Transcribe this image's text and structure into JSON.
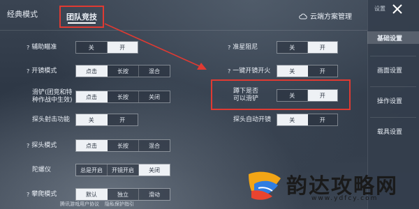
{
  "tabs": {
    "classic": "经典模式",
    "team": "团队竞技"
  },
  "cloud_manage": "云端方案管理",
  "left_rows": [
    {
      "label": "辅助瞄准",
      "help": "?",
      "options": [
        "关",
        "开"
      ],
      "selected": 1
    },
    {
      "label": "开镜模式",
      "help": "?",
      "options": [
        "点击",
        "长按",
        "混合"
      ],
      "selected": 0
    },
    {
      "label": "滑铲(团竞和特种作战中生效)",
      "label_line1": "滑铲(团竞和特",
      "label_line2": "种作战中生效)",
      "help": "",
      "options": [
        "点击",
        "长按",
        "关闭"
      ],
      "selected": 0
    },
    {
      "label": "探头射击功能",
      "help": "",
      "options": [
        "关",
        "开"
      ],
      "selected": 0
    },
    {
      "label": "探头模式",
      "help": "?",
      "options": [
        "点击",
        "长按",
        "混合"
      ],
      "selected": 0
    },
    {
      "label": "陀螺仪",
      "help": "",
      "options": [
        "总是开启",
        "开镜开启",
        "关闭"
      ],
      "selected": 2
    },
    {
      "label": "攀爬模式",
      "help": "?",
      "options": [
        "默认",
        "独立",
        "滑动"
      ],
      "selected": 0
    }
  ],
  "right_rows": [
    {
      "label": "准星阻尼",
      "help": "?",
      "options": [
        "关",
        "开"
      ],
      "selected": 1
    },
    {
      "label": "一键开镜开火",
      "help": "?",
      "options": [
        "关",
        "开"
      ],
      "selected": 0
    },
    {
      "label_line1": "蹲下是否",
      "label_line2": "可以滑铲",
      "help": "",
      "options": [
        "关",
        "开"
      ],
      "selected": 1
    },
    {
      "label": "探头自动开镜",
      "help": "",
      "options": [
        "关",
        "开"
      ],
      "selected": 0
    }
  ],
  "sidebar": {
    "title": "设置",
    "items": [
      "基础设置",
      "画面设置",
      "操作设置",
      "载具设置"
    ],
    "active": 0
  },
  "bottom_links": [
    "腾讯游戏用户协议",
    "隐私保护指引"
  ],
  "watermark": {
    "text": "韵达攻略网",
    "url": "www.ydfcy.com"
  },
  "colors": {
    "highlight": "#e03a32",
    "selected_bg": "#eef1f5",
    "panel_bg": "#2d3745"
  }
}
